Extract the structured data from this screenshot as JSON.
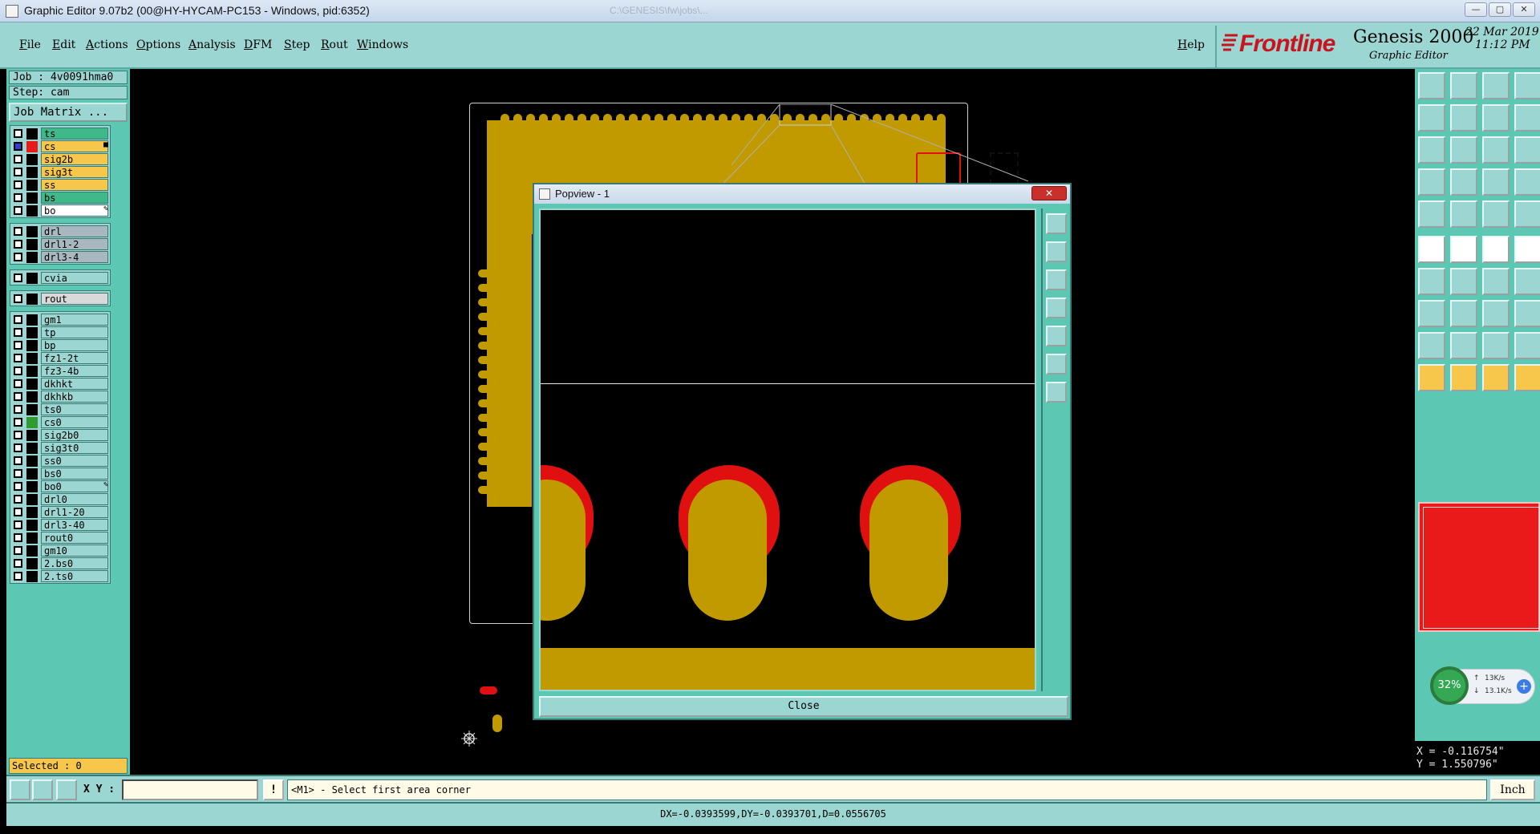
{
  "window": {
    "title": "Graphic Editor 9.07b2 (00@HY-HYCAM-PC153 - Windows, pid:6352)",
    "background_title": "C:\\GENESIS\\fw\\jobs\\...",
    "buttons": [
      "minimize",
      "maximize",
      "close"
    ]
  },
  "menu": {
    "items": [
      "File",
      "Edit",
      "Actions",
      "Options",
      "Analysis",
      "DFM",
      "Step",
      "Rout",
      "Windows"
    ],
    "help": "Help"
  },
  "brand": {
    "logo": "Frontline",
    "product": "Genesis 2000",
    "subtitle": "Graphic Editor",
    "date": "22 Mar 2019",
    "time": "11:12 PM"
  },
  "job": {
    "job_label": "Job : 4v0091hma0",
    "step_label": "Step: cam",
    "matrix_button": "Job Matrix ..."
  },
  "layers": {
    "groups": [
      [
        {
          "name": "ts",
          "color": "#3fb98a",
          "swatch": "#000000",
          "marker": ""
        },
        {
          "name": "cs",
          "color": "#f6c74a",
          "swatch": "#e81a1a",
          "marker": "■",
          "selected": true
        },
        {
          "name": "sig2b",
          "color": "#f6c74a",
          "swatch": "#000000",
          "marker": ""
        },
        {
          "name": "sig3t",
          "color": "#f6c74a",
          "swatch": "#000000",
          "marker": ""
        },
        {
          "name": "ss",
          "color": "#f6c74a",
          "swatch": "#000000",
          "marker": ""
        },
        {
          "name": "bs",
          "color": "#3fb98a",
          "swatch": "#000000",
          "marker": ""
        },
        {
          "name": "bo",
          "color": "#ffffff",
          "swatch": "#000000",
          "marker": "✎"
        }
      ],
      [
        {
          "name": "drl",
          "color": "#a9b8bf",
          "swatch": "#000000",
          "marker": ""
        },
        {
          "name": "drl1-2",
          "color": "#a9b8bf",
          "swatch": "#000000",
          "marker": ""
        },
        {
          "name": "drl3-4",
          "color": "#a9b8bf",
          "swatch": "#000000",
          "marker": ""
        }
      ],
      [
        {
          "name": "cvia",
          "color": "#9cd6d2",
          "swatch": "#000000",
          "marker": ""
        }
      ],
      [
        {
          "name": "rout",
          "color": "#d9d9d9",
          "swatch": "#000000",
          "marker": ""
        }
      ],
      [
        {
          "name": "gm1",
          "color": "#9cd6d2",
          "swatch": "#000000",
          "marker": ""
        },
        {
          "name": "tp",
          "color": "#9cd6d2",
          "swatch": "#000000",
          "marker": ""
        },
        {
          "name": "bp",
          "color": "#9cd6d2",
          "swatch": "#000000",
          "marker": ""
        },
        {
          "name": "fz1-2t",
          "color": "#9cd6d2",
          "swatch": "#000000",
          "marker": ""
        },
        {
          "name": "fz3-4b",
          "color": "#9cd6d2",
          "swatch": "#000000",
          "marker": ""
        },
        {
          "name": "dkhkt",
          "color": "#9cd6d2",
          "swatch": "#000000",
          "marker": ""
        },
        {
          "name": "dkhkb",
          "color": "#9cd6d2",
          "swatch": "#000000",
          "marker": ""
        },
        {
          "name": "ts0",
          "color": "#9cd6d2",
          "swatch": "#000000",
          "marker": ""
        },
        {
          "name": "cs0",
          "color": "#9cd6d2",
          "swatch": "#2f9a2f",
          "marker": ""
        },
        {
          "name": "sig2b0",
          "color": "#9cd6d2",
          "swatch": "#000000",
          "marker": ""
        },
        {
          "name": "sig3t0",
          "color": "#9cd6d2",
          "swatch": "#000000",
          "marker": ""
        },
        {
          "name": "ss0",
          "color": "#9cd6d2",
          "swatch": "#000000",
          "marker": ""
        },
        {
          "name": "bs0",
          "color": "#9cd6d2",
          "swatch": "#000000",
          "marker": ""
        },
        {
          "name": "bo0",
          "color": "#9cd6d2",
          "swatch": "#000000",
          "marker": "✎"
        },
        {
          "name": "drl0",
          "color": "#9cd6d2",
          "swatch": "#000000",
          "marker": ""
        },
        {
          "name": "drl1-20",
          "color": "#9cd6d2",
          "swatch": "#000000",
          "marker": ""
        },
        {
          "name": "drl3-40",
          "color": "#9cd6d2",
          "swatch": "#000000",
          "marker": ""
        },
        {
          "name": "rout0",
          "color": "#9cd6d2",
          "swatch": "#000000",
          "marker": ""
        },
        {
          "name": "gm10",
          "color": "#9cd6d2",
          "swatch": "#000000",
          "marker": ""
        },
        {
          "name": "2.bs0",
          "color": "#9cd6d2",
          "swatch": "#000000",
          "marker": ""
        },
        {
          "name": "2.ts0",
          "color": "#9cd6d2",
          "swatch": "#000000",
          "marker": ""
        }
      ]
    ]
  },
  "selected": "Selected : 0",
  "popview": {
    "title": "Popview - 1",
    "close_button": "Close",
    "tools": [
      "zoom-home-icon",
      "pan-up-icon",
      "pan-down-icon",
      "pan-left-icon",
      "pan-right-icon",
      "zoom-in-icon",
      "zoom-out-icon"
    ]
  },
  "network_widget": {
    "percent": "32%",
    "upload": "13K/s",
    "download": "13.1K/s"
  },
  "coords": {
    "x": "X = -0.116754\"",
    "y": "Y = 1.550796\""
  },
  "command": {
    "xy_label": "X Y :",
    "xy_value": "",
    "bang": "!",
    "prompt": "<M1> - Select first area corner",
    "units": "Inch"
  },
  "status": "DX=-0.0393599,DY=-0.0393701,D=0.0556705",
  "colors": {
    "copper": "#c19a00",
    "pad_red": "#e01010",
    "panel_teal": "#5cc8b4",
    "panel_light": "#9cd6d2",
    "brand_red": "#c8141e"
  }
}
